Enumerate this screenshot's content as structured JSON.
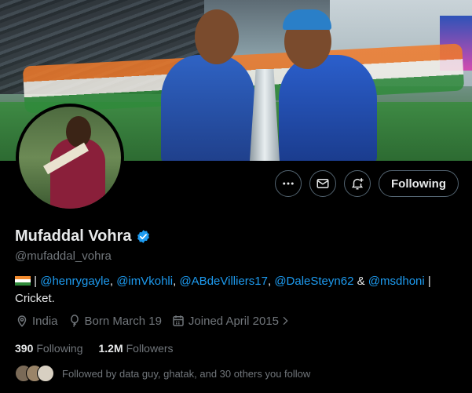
{
  "profile": {
    "name": "Mufaddal Vohra",
    "handle": "@mufaddal_vohra",
    "verified": true,
    "bio": {
      "flag": "india-flag",
      "sep1": " | ",
      "mentions": [
        "@henrygayle",
        "@imVkohli",
        "@ABdeVilliers17",
        "@DaleSteyn62",
        "@msdhoni"
      ],
      "comma": ", ",
      "amp": " & ",
      "sep2": " |",
      "line2": "Cricket."
    },
    "location": "India",
    "born": "Born March 19",
    "joined": "Joined April 2015",
    "following_count": "390",
    "following_label": "Following",
    "followers_count": "1.2M",
    "followers_label": "Followers",
    "followed_by": "Followed by data guy, ghatak, and 30 others you follow"
  },
  "actions": {
    "more": "more-icon",
    "message": "mail-icon",
    "notify": "bell-plus-icon",
    "follow_label": "Following"
  },
  "colors": {
    "background": "#000000",
    "text": "#e7e9ea",
    "muted": "#71767b",
    "link": "#1d9bf0",
    "border": "#536471"
  }
}
